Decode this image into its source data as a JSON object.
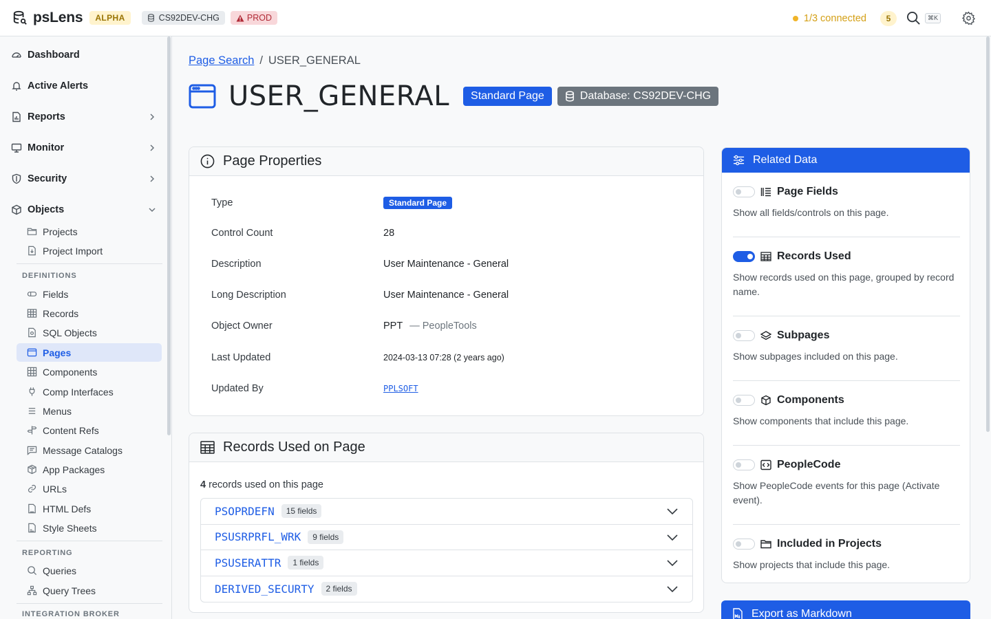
{
  "header": {
    "app_name": "psLens",
    "alpha_badge": "ALPHA",
    "db_badge": "CS92DEV-CHG",
    "env_badge": "PROD",
    "connection_status": "1/3 connected",
    "alert_count": "5",
    "search_shortcut": "⌘K",
    "colors": {
      "accent": "#1e5de5",
      "warning": "#f0b429",
      "danger": "#b02a37"
    }
  },
  "sidebar": {
    "top_items": [
      {
        "label": "Dashboard",
        "icon": "dashboard-icon"
      },
      {
        "label": "Active Alerts",
        "icon": "bell-icon"
      },
      {
        "label": "Reports",
        "icon": "report-icon"
      },
      {
        "label": "Monitor",
        "icon": "monitor-icon"
      },
      {
        "label": "Security",
        "icon": "shield-icon"
      },
      {
        "label": "Objects",
        "icon": "cube-icon"
      }
    ],
    "objects_items": [
      {
        "label": "Projects",
        "icon": "folder-icon"
      },
      {
        "label": "Project Import",
        "icon": "file-import-icon"
      }
    ],
    "definitions_header": "DEFINITIONS",
    "definitions_items": [
      {
        "label": "Fields",
        "icon": "field-icon"
      },
      {
        "label": "Records",
        "icon": "table-icon"
      },
      {
        "label": "SQL Objects",
        "icon": "sql-file-icon"
      },
      {
        "label": "Pages",
        "icon": "page-window-icon"
      },
      {
        "label": "Components",
        "icon": "grid-icon"
      },
      {
        "label": "Comp Interfaces",
        "icon": "plug-icon"
      },
      {
        "label": "Menus",
        "icon": "menu-icon"
      },
      {
        "label": "Content Refs",
        "icon": "signpost-icon"
      },
      {
        "label": "Message Catalogs",
        "icon": "message-icon"
      },
      {
        "label": "App Packages",
        "icon": "package-icon"
      },
      {
        "label": "URLs",
        "icon": "link-icon"
      },
      {
        "label": "HTML Defs",
        "icon": "html-file-icon"
      },
      {
        "label": "Style Sheets",
        "icon": "css-file-icon"
      }
    ],
    "reporting_header": "REPORTING",
    "reporting_items": [
      {
        "label": "Queries",
        "icon": "search-icon"
      },
      {
        "label": "Query Trees",
        "icon": "tree-icon"
      }
    ],
    "integration_header": "INTEGRATION BROKER"
  },
  "main": {
    "breadcrumb": {
      "parent": "Page Search",
      "separator": "/",
      "current": "USER_GENERAL"
    },
    "title": "USER_GENERAL",
    "type_badge": "Standard Page",
    "db_badge": "Database: CS92DEV-CHG",
    "properties": {
      "heading": "Page Properties",
      "rows": [
        {
          "label": "Type",
          "value": "Standard Page"
        },
        {
          "label": "Control Count",
          "value": "28"
        },
        {
          "label": "Description",
          "value": "User Maintenance - General"
        },
        {
          "label": "Long Description",
          "value": "User Maintenance - General"
        },
        {
          "label": "Object Owner",
          "value": "PPT",
          "desc": "— PeopleTools"
        },
        {
          "label": "Last Updated",
          "value": "2024-03-13 07:28 (2 years ago)"
        },
        {
          "label": "Updated By",
          "value": "PPLSOFT"
        }
      ]
    },
    "records": {
      "heading": "Records Used on Page",
      "count": "4",
      "count_suffix": "records used on this page",
      "items": [
        {
          "name": "PSOPRDEFN",
          "fields": "15 fields"
        },
        {
          "name": "PSUSRPRFL_WRK",
          "fields": "9 fields"
        },
        {
          "name": "PSUSERATTR",
          "fields": "1 fields"
        },
        {
          "name": "DERIVED_SECURTY",
          "fields": "2 fields"
        }
      ]
    }
  },
  "related": {
    "heading": "Related Data",
    "items": [
      {
        "title": "Page Fields",
        "desc": "Show all fields/controls on this page.",
        "enabled": false
      },
      {
        "title": "Records Used",
        "desc": "Show records used on this page, grouped by record name.",
        "enabled": true
      },
      {
        "title": "Subpages",
        "desc": "Show subpages included on this page.",
        "enabled": false
      },
      {
        "title": "Components",
        "desc": "Show components that include this page.",
        "enabled": false
      },
      {
        "title": "PeopleCode",
        "desc": "Show PeopleCode events for this page (Activate event).",
        "enabled": false
      },
      {
        "title": "Included in Projects",
        "desc": "Show projects that include this page.",
        "enabled": false
      }
    ],
    "export_label": "Export as Markdown"
  }
}
